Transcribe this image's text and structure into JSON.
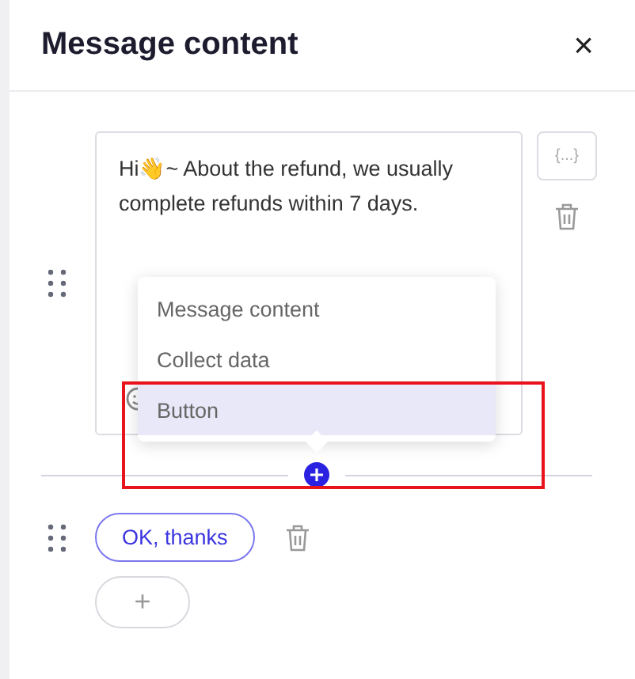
{
  "panel": {
    "title": "Message content",
    "close": "×"
  },
  "message": {
    "text": "Hi👋~ About the refund, we usually complete refunds within 7 days.",
    "variable_button": "{...}"
  },
  "insert_menu": {
    "items": [
      {
        "label": "Message content",
        "selected": false
      },
      {
        "label": "Collect data",
        "selected": false
      },
      {
        "label": "Button",
        "selected": true
      }
    ]
  },
  "buttons": [
    {
      "label": "OK, thanks"
    }
  ],
  "add_button": "+"
}
